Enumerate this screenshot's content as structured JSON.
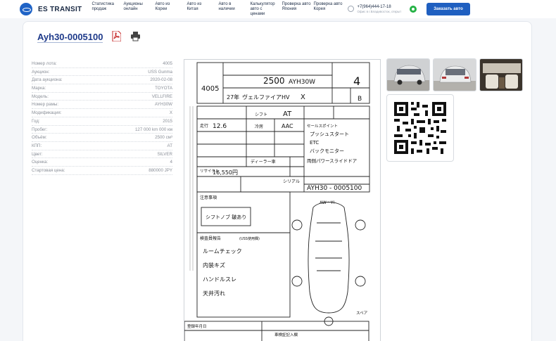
{
  "header": {
    "brand": "ES TRANSIT",
    "nav": [
      {
        "label": "Статистика\nпродаж"
      },
      {
        "label": "Аукционы\nонлайн"
      },
      {
        "label": "Авто из\nКореи"
      },
      {
        "label": "Авто из\nКитая"
      },
      {
        "label": "Авто в\nналичии"
      },
      {
        "label": "Калькулятор авто с\nценами"
      },
      {
        "label": "Проверка авто\nЯпония"
      },
      {
        "label": "Проверка авто\nКорея"
      }
    ],
    "phone": "+7(964)444-17-18",
    "office": "Офис в г.Владивосток, открыт",
    "order_button": "Заказать авто",
    "icons": {
      "logo": "logo-icon",
      "phone": "phone-icon",
      "whatsapp": "whatsapp-icon"
    }
  },
  "lot": {
    "title": "Ayh30-0005100",
    "icons": {
      "pdf": "pdf-icon",
      "print": "printer-icon"
    }
  },
  "specs": [
    {
      "label": "Номер лота:",
      "value": "4005"
    },
    {
      "label": "Аукцион:",
      "value": "USS Gunma"
    },
    {
      "label": "Дата аукциона:",
      "value": "2020-02-08"
    },
    {
      "label": "Марка:",
      "value": "TOYOTA"
    },
    {
      "label": "Модель:",
      "value": "VELLFIRE"
    },
    {
      "label": "Номер рамы:",
      "value": "AYH30W"
    },
    {
      "label": "Модификация:",
      "value": "X"
    },
    {
      "label": "Год:",
      "value": "2015"
    },
    {
      "label": "Пробег:",
      "value": "127 000 km 000 км"
    },
    {
      "label": "Объём:",
      "value": "2500 см³"
    },
    {
      "label": "КПП:",
      "value": "AT"
    },
    {
      "label": "Цвет:",
      "value": "SILVER"
    },
    {
      "label": "Оценка:",
      "value": "4"
    },
    {
      "label": "Стартовая цена:",
      "value": "880000 JPY"
    }
  ],
  "auction_sheet": {
    "lot_no": "4005",
    "displacement": "2500",
    "grade_code": "AYH30W",
    "model_jp": "ヴェルファイアHV",
    "trim": "X",
    "score": "4",
    "interior": "B",
    "year": "27年",
    "mileage": "12.6",
    "transmission": "AT",
    "ac": "AAC",
    "serial": "AYH30 - 0005100",
    "recycle": "16,550円",
    "notes_box": "シフトノブ 皺あり",
    "remarks": [
      "プッシュスタート",
      "ETC",
      "バックモニター",
      "両側パワースライドドア"
    ],
    "handwritten": [
      "ルームチェック",
      "内装キズ",
      "ハンドルスレ",
      "天井汚れ"
    ],
    "labels": {
      "shift": "シフト",
      "cooler": "冷房",
      "sales_points": "セールスポイント",
      "mileage_label": "走行",
      "serial_label": "シリアル",
      "notes_label": "注意事項",
      "inspector_label": "検査員報告",
      "uss_label": "(USS使用欄)",
      "recycle_label": "リサイクル",
      "dealer": "ディーラー車",
      "spare": "スペア",
      "diagram_label": "AW・Y!",
      "bottom_label": "車検証記入欄",
      "bottom_left": "登録年月日"
    }
  },
  "photos": [
    {
      "name": "front-photo"
    },
    {
      "name": "rear-photo"
    },
    {
      "name": "interior-photo"
    }
  ],
  "qr": {
    "name": "qr-code"
  }
}
